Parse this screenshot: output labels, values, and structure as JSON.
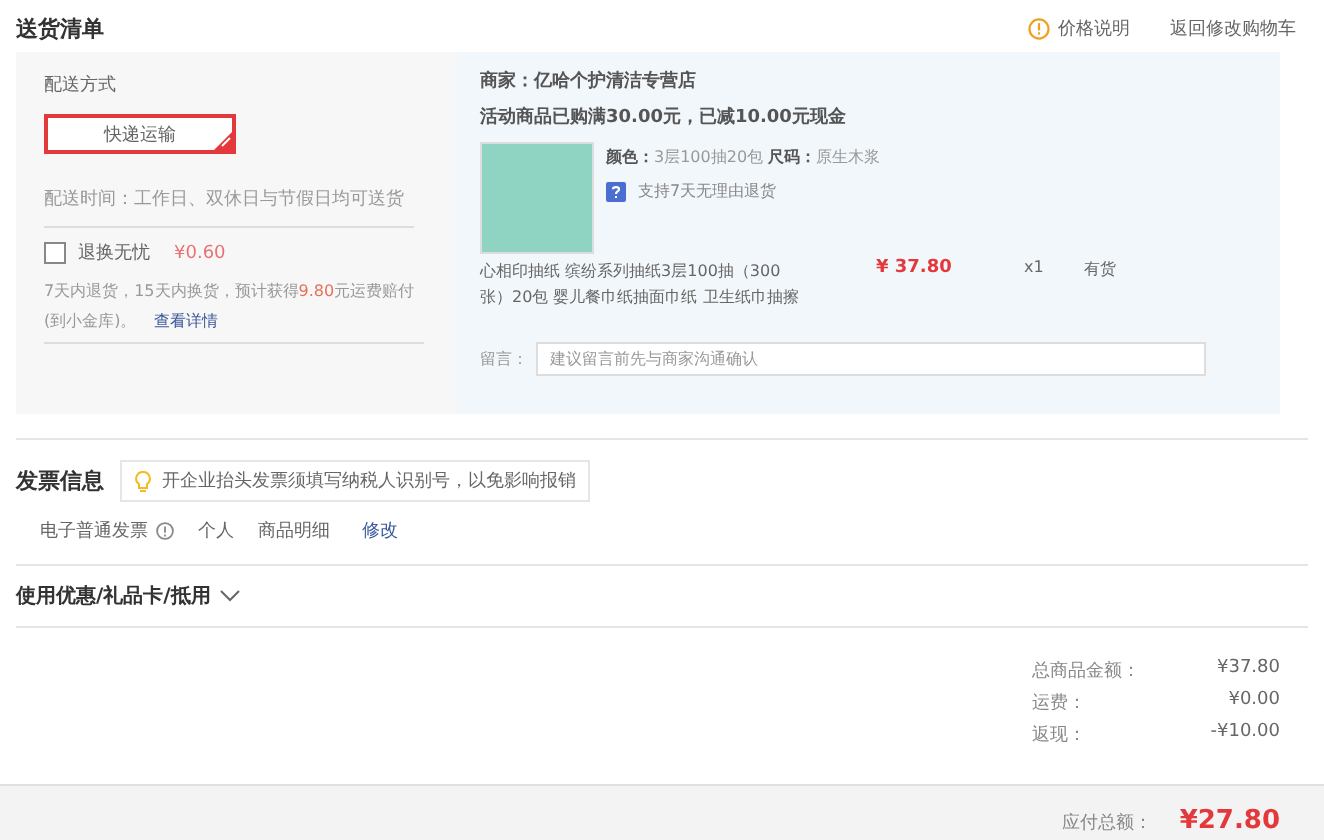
{
  "header": {
    "title": "送货清单",
    "price_note": "价格说明",
    "back_link": "返回修改购物车"
  },
  "shipping": {
    "label": "配送方式",
    "method": {
      "label": "快递运输",
      "selected": true
    },
    "time": "配送时间：工作日、双休日与节假日均可送货",
    "insurance": {
      "label": "退换无忧",
      "price": "¥0.60",
      "checked": false,
      "desc": "7天内退货，15天内换货，预计获得**9.80**元运费赔付(到小金库)。",
      "link": "查看详情"
    }
  },
  "store": {
    "seller": "商家：亿哈个护清洁专营店",
    "promo": "活动商品已购满30.00元，已减10.00元现金",
    "product": {
      "color_label": "颜色：",
      "variant": "3层100抽20包",
      "size_label": "尺码：",
      "size": "原生木浆",
      "return_badge": "支持7天无理由退货",
      "name": "心相印抽纸 缤纷系列抽纸3层100抽（300张）20包 婴儿餐巾纸抽面巾纸 卫生纸巾抽擦",
      "price": "¥ 37.80",
      "qty": "x1",
      "stock": "有货"
    },
    "note_label": "留言：",
    "note_placeholder": "建议留言前先与商家沟通确认"
  },
  "invoice": {
    "title": "发票信息",
    "tip": "开企业抬头发票须填写纳税人识别号，以免影响报销",
    "type": "电子普通发票",
    "holder": "个人",
    "content": "商品明细",
    "edit": "修改"
  },
  "coupon": {
    "title": "使用优惠/礼品卡/抵用"
  },
  "summary": {
    "rows": [
      {
        "label": "总商品金额：",
        "value": "¥37.80"
      },
      {
        "label": "运费：",
        "value": "¥0.00"
      },
      {
        "label": "返现：",
        "value": "-¥10.00"
      }
    ],
    "total_label": "应付总额：",
    "total": "¥27.80"
  }
}
